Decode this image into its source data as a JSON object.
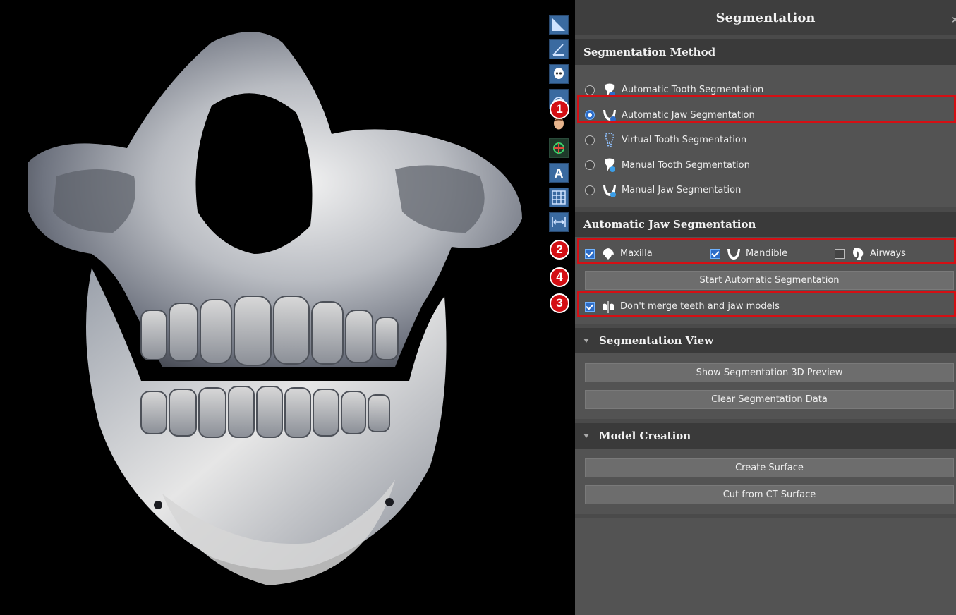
{
  "panel": {
    "title": "Segmentation",
    "close_icon": "×"
  },
  "segmentation_method": {
    "title": "Segmentation Method",
    "options": [
      {
        "label": "Automatic Tooth Segmentation",
        "icon": "tooth-auto-icon",
        "selected": false
      },
      {
        "label": "Automatic Jaw Segmentation",
        "icon": "jaw-auto-icon",
        "selected": true
      },
      {
        "label": "Virtual Tooth Segmentation",
        "icon": "tooth-virtual-icon",
        "selected": false
      },
      {
        "label": "Manual Tooth Segmentation",
        "icon": "tooth-manual-icon",
        "selected": false
      },
      {
        "label": "Manual Jaw Segmentation",
        "icon": "jaw-manual-icon",
        "selected": false
      }
    ]
  },
  "automatic_jaw": {
    "title": "Automatic Jaw Segmentation",
    "maxilla_label": "Maxilla",
    "maxilla_checked": true,
    "mandible_label": "Mandible",
    "mandible_checked": true,
    "airways_label": "Airways",
    "airways_checked": false,
    "start_button": "Start Automatic Segmentation",
    "dont_merge_label": "Don't merge teeth and jaw models",
    "dont_merge_checked": true
  },
  "segmentation_view": {
    "title": "Segmentation View",
    "show_3d_button": "Show Segmentation 3D Preview",
    "clear_button": "Clear Segmentation Data"
  },
  "model_creation": {
    "title": "Model Creation",
    "create_surface_button": "Create Surface",
    "cut_button": "Cut from CT Surface"
  },
  "annotations": {
    "badge_1": "1",
    "badge_2": "2",
    "badge_3": "3",
    "badge_4": "4"
  },
  "toolbar_icons": [
    "viewport-triangle-icon",
    "angle-measure-icon",
    "skull-icon",
    "curve-icon",
    "face-icon",
    "orientation-icon",
    "annotation-a-icon",
    "grid-icon",
    "distance-icon"
  ],
  "colors": {
    "accent_blue": "#2d6cc7",
    "annotation_red": "#d40f14",
    "panel_bg": "#535353",
    "header_bg": "#3a3a3a"
  }
}
